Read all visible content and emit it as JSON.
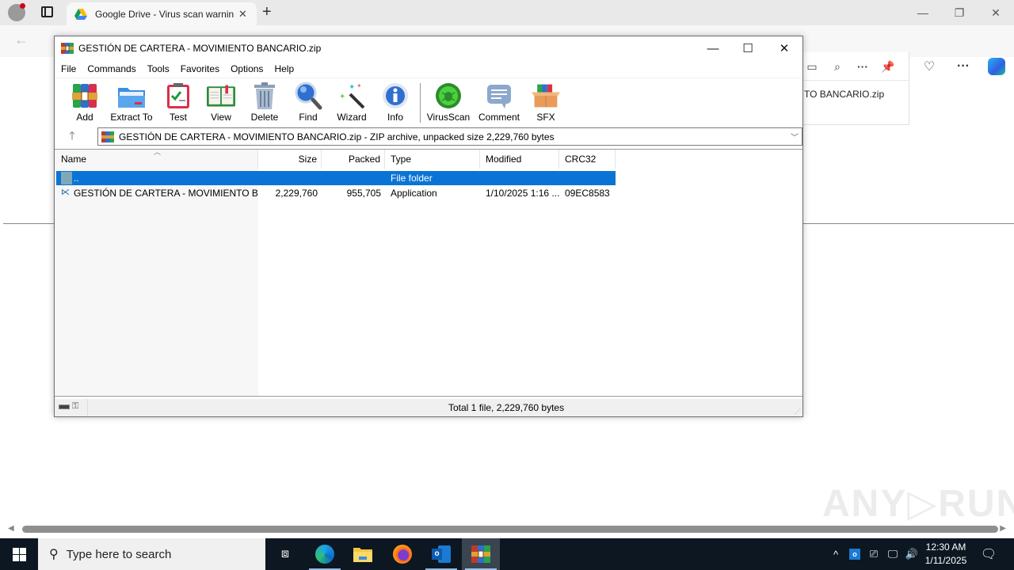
{
  "browser": {
    "tab_title": "Google Drive - Virus scan warning",
    "tab_close": "✕",
    "new_tab": "+",
    "window_controls": {
      "minimize": "—",
      "restore": "❐",
      "close": "✕"
    },
    "toolbar_icons": [
      "favorites-icon",
      "collections-icon",
      "downloads-icon",
      "browser-essentials-icon",
      "more-icon",
      "copilot-icon"
    ],
    "downloads_panel": {
      "file_name_fragment": "TO BANCARIO.zip"
    }
  },
  "winrar": {
    "title": "GESTIÓN DE CARTERA - MOVIMIENTO BANCARIO.zip",
    "window_controls": {
      "minimize": "—",
      "maximize": "☐",
      "close": "✕"
    },
    "menu": [
      "File",
      "Commands",
      "Tools",
      "Favorites",
      "Options",
      "Help"
    ],
    "toolbar": [
      {
        "label": "Add",
        "icon": "add-archive-icon"
      },
      {
        "label": "Extract To",
        "icon": "extract-folder-icon"
      },
      {
        "label": "Test",
        "icon": "test-clipboard-icon"
      },
      {
        "label": "View",
        "icon": "view-book-icon"
      },
      {
        "label": "Delete",
        "icon": "trash-icon"
      },
      {
        "label": "Find",
        "icon": "magnifier-icon"
      },
      {
        "label": "Wizard",
        "icon": "wizard-wand-icon"
      },
      {
        "label": "Info",
        "icon": "info-icon"
      },
      {
        "label": "VirusScan",
        "icon": "virus-scan-icon"
      },
      {
        "label": "Comment",
        "icon": "comment-icon"
      },
      {
        "label": "SFX",
        "icon": "sfx-box-icon"
      }
    ],
    "path": "GESTIÓN DE CARTERA - MOVIMIENTO BANCARIO.zip - ZIP archive, unpacked size 2,229,760 bytes",
    "columns": [
      "Name",
      "Size",
      "Packed",
      "Type",
      "Modified",
      "CRC32"
    ],
    "rows": [
      {
        "name": "..",
        "size": "",
        "packed": "",
        "type": "File folder",
        "modified": "",
        "crc": "",
        "selected": true
      },
      {
        "name": "GESTIÓN DE CARTERA - MOVIMIENTO BA...",
        "size": "2,229,760",
        "packed": "955,705",
        "type": "Application",
        "modified": "1/10/2025 1:16 ...",
        "crc": "09EC8583",
        "selected": false
      }
    ],
    "status": "Total 1 file, 2,229,760 bytes"
  },
  "watermark": "ANY▷RUN",
  "taskbar": {
    "search_placeholder": "Type here to search",
    "time": "12:30 AM",
    "date": "1/11/2025",
    "apps": [
      "task-view",
      "edge",
      "file-explorer",
      "firefox",
      "outlook",
      "winrar"
    ]
  }
}
